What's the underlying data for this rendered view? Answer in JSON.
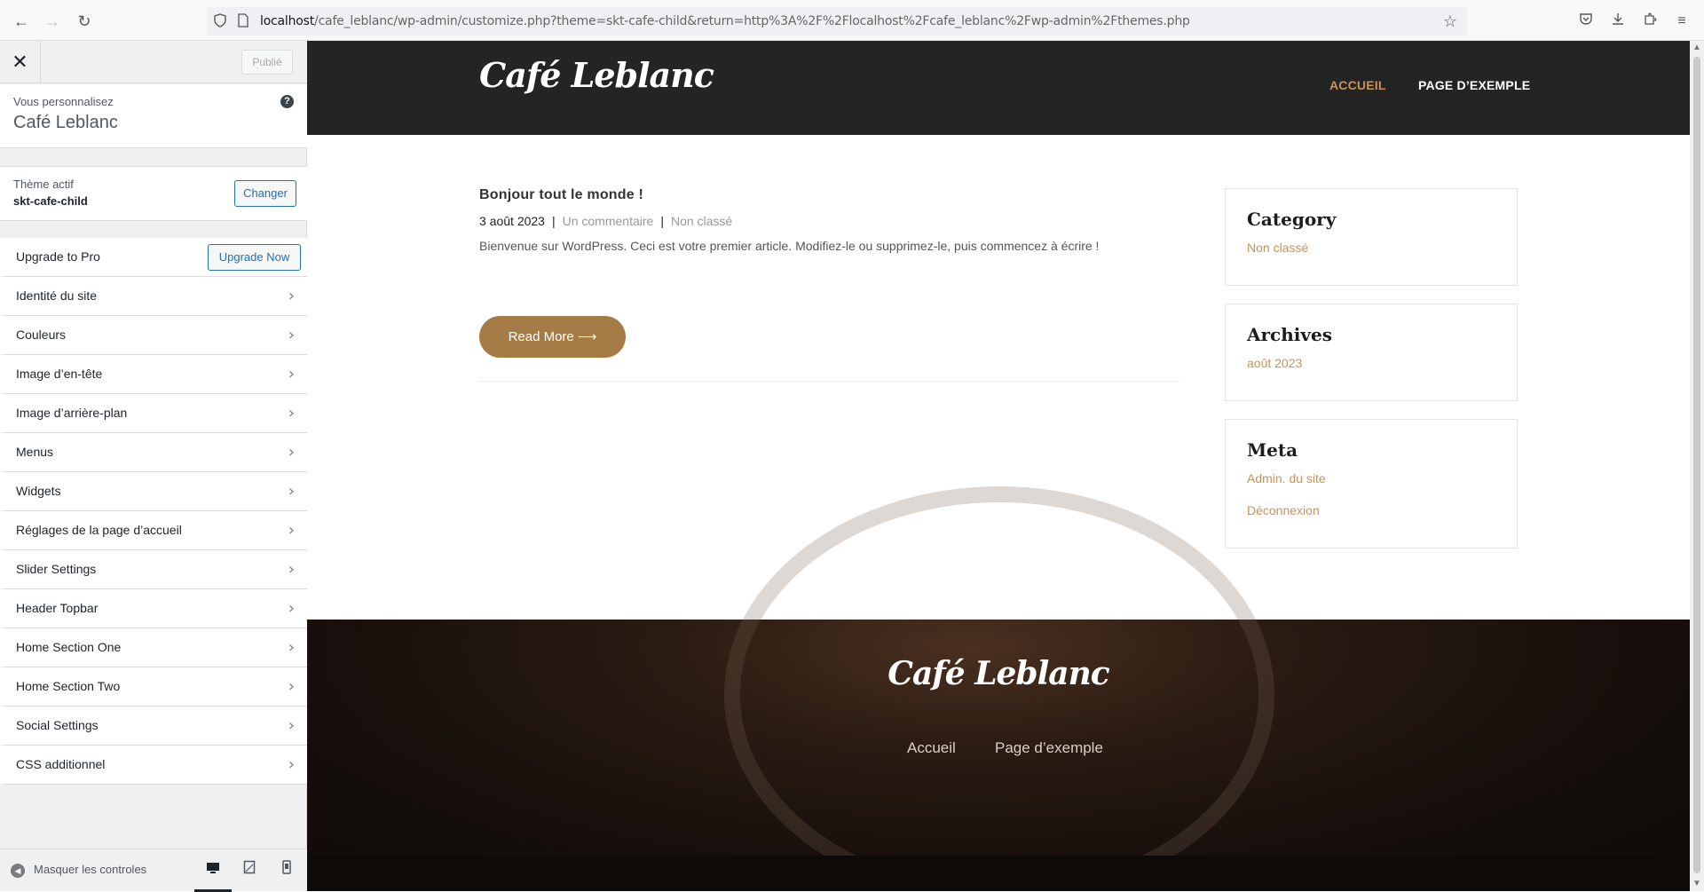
{
  "browser": {
    "back_icon": "←",
    "forward_icon": "→",
    "reload_icon": "↻",
    "url_host": "localhost",
    "url_path": "/cafe_leblanc/wp-admin/customize.php?theme=skt-cafe-child&return=http%3A%2F%2Flocalhost%2Fcafe_leblanc%2Fwp-admin%2Fthemes.php",
    "star_icon": "☆",
    "pocket_icon": "◡",
    "download_icon": "⤓",
    "extensions_icon": "⧉",
    "menu_icon": "≡"
  },
  "sidebar": {
    "close_icon": "✕",
    "publish_label": "Publié",
    "customizing_label": "Vous personnalisez",
    "site_name": "Café Leblanc",
    "help_icon": "?",
    "active_theme_label": "Thème actif",
    "active_theme_name": "skt-cafe-child",
    "change_label": "Changer",
    "upgrade_label": "Upgrade to Pro",
    "upgrade_button": "Upgrade Now",
    "panels": [
      {
        "label": "Identité du site"
      },
      {
        "label": "Couleurs"
      },
      {
        "label": "Image d’en-tête"
      },
      {
        "label": "Image d’arrière-plan"
      },
      {
        "label": "Menus"
      },
      {
        "label": "Widgets"
      },
      {
        "label": "Réglages de la page d’accueil"
      },
      {
        "label": "Slider Settings"
      },
      {
        "label": "Header Topbar"
      },
      {
        "label": "Home Section One"
      },
      {
        "label": "Home Section Two"
      },
      {
        "label": "Social Settings"
      },
      {
        "label": "CSS additionnel"
      }
    ],
    "chevron": "›",
    "hide_controls_label": "Masquer les controles",
    "hide_controls_icon": "◀",
    "device_desktop_icon": "▭",
    "device_tablet_icon": "▯",
    "device_mobile_icon": "▯"
  },
  "preview": {
    "site_title": "Café Leblanc",
    "nav": [
      "ACCUEIL",
      "PAGE D’EXEMPLE"
    ],
    "post": {
      "title": "Bonjour tout le monde !",
      "date": "3 août 2023",
      "comments": "Un commentaire",
      "category": "Non classé",
      "separator": "|",
      "excerpt": "Bienvenue sur WordPress. Ceci est votre premier article. Modifiez-le ou supprimez-le, puis commencez à écrire !",
      "read_more": "Read More ⟶"
    },
    "widgets": {
      "category_title": "Category",
      "category_link": "Non classé",
      "archives_title": "Archives",
      "archives_link": "août 2023",
      "meta_title": "Meta",
      "meta_link1": "Admin. du site",
      "meta_link2": "Déconnexion"
    },
    "footer": {
      "site_title": "Café Leblanc",
      "nav": [
        "Accueil",
        "Page d’exemple"
      ]
    }
  },
  "colors": {
    "accent": "#c8925a",
    "button": "#a57c45",
    "wp_blue": "#2271b1",
    "header_bg": "#242424"
  }
}
